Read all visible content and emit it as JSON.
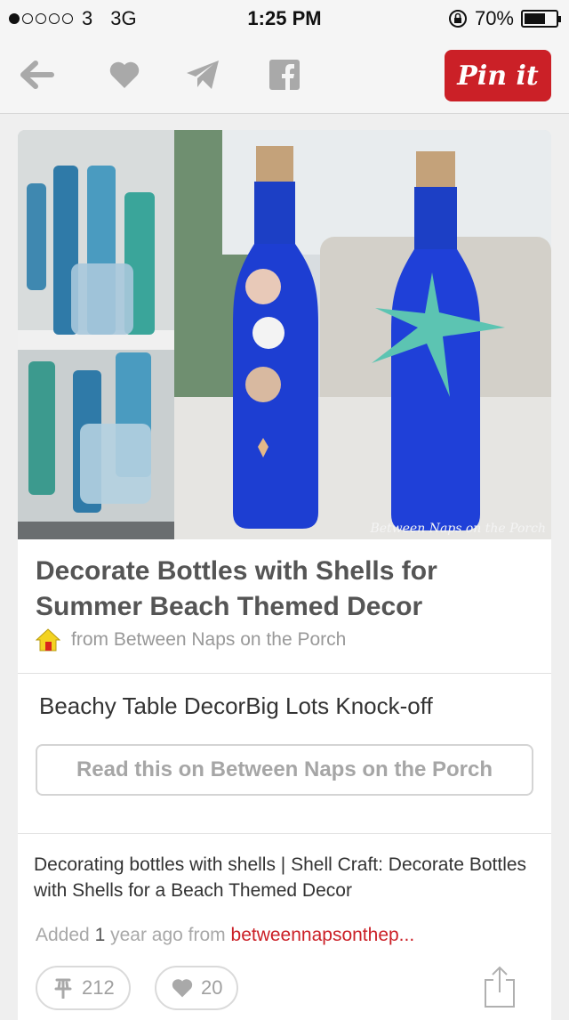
{
  "status_bar": {
    "carrier": "3",
    "network": "3G",
    "time": "1:25 PM",
    "battery": "70%",
    "battery_level": 0.7
  },
  "toolbar": {
    "back_icon": "arrow-left-icon",
    "like_icon": "heart-icon",
    "send_icon": "paper-plane-icon",
    "facebook_icon": "facebook-icon",
    "pin_label": "Pin it"
  },
  "pin": {
    "watermark": "Between Naps on the Porch",
    "title": "Decorate Bottles with Shells for Summer Beach Themed Decor",
    "source_label": "from Between Naps on the Porch",
    "description": "Beachy Table DecorBig Lots Knock-off",
    "read_button": "Read this on Between Naps on the Porch"
  },
  "related": {
    "title": "Decorating bottles with shells | Shell Craft: Decorate Bottles with Shells for a Beach Themed Decor",
    "added_prefix": "Added",
    "added_num": "1",
    "added_mid": "year ago from",
    "source_link": "betweennapsonthep...",
    "repins": "212",
    "likes": "20"
  },
  "colors": {
    "brand": "#cb2027",
    "icon_gray": "#a9a9a9"
  }
}
